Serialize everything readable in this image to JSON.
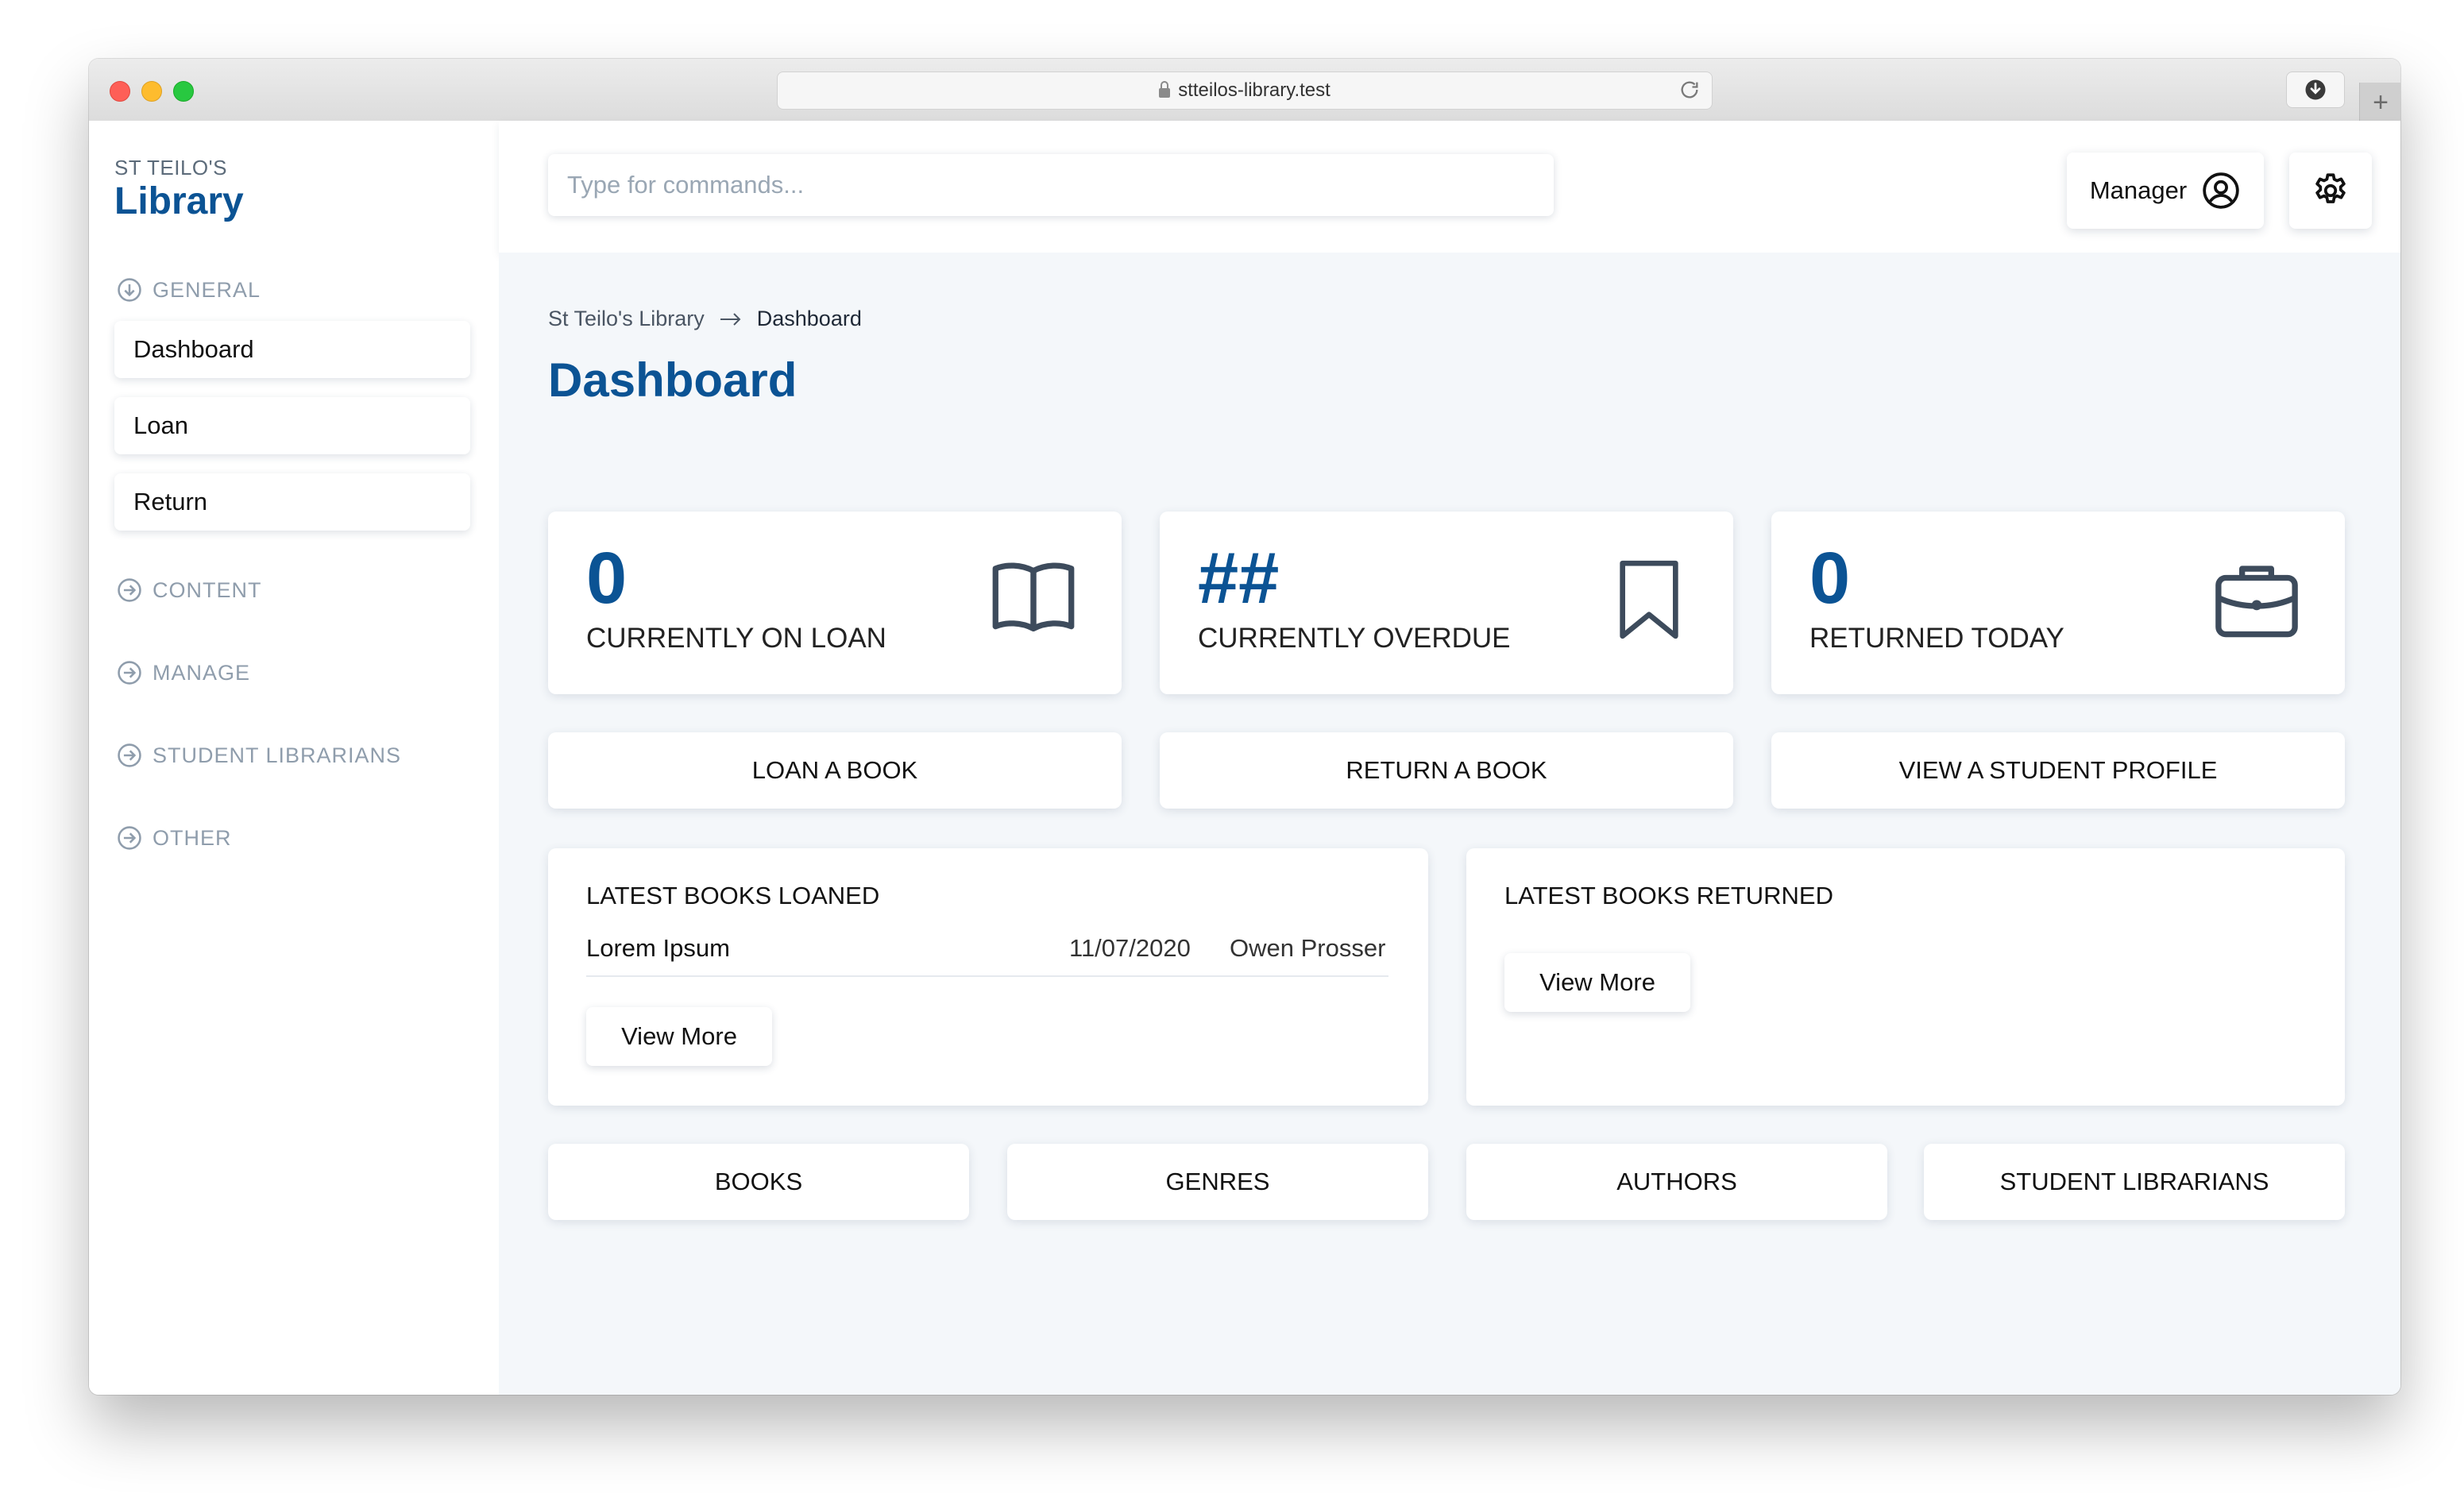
{
  "browser": {
    "url": "stteilos-library.test",
    "new_tab": "+"
  },
  "sidebar": {
    "brand_top": "ST TEILO'S",
    "brand_main": "Library",
    "sections": [
      {
        "label": "GENERAL",
        "items": [
          {
            "label": "Dashboard"
          },
          {
            "label": "Loan"
          },
          {
            "label": "Return"
          }
        ]
      },
      {
        "label": "CONTENT"
      },
      {
        "label": "MANAGE"
      },
      {
        "label": "STUDENT LIBRARIANS"
      },
      {
        "label": "OTHER"
      }
    ]
  },
  "topbar": {
    "search_placeholder": "Type for commands...",
    "user_label": "Manager"
  },
  "breadcrumb": {
    "root": "St Teilo's Library",
    "current": "Dashboard"
  },
  "page_title": "Dashboard",
  "stats": [
    {
      "value": "0",
      "label": "CURRENTLY ON LOAN",
      "icon": "book-open-icon"
    },
    {
      "value": "##",
      "label": "CURRENTLY OVERDUE",
      "icon": "bookmark-icon"
    },
    {
      "value": "0",
      "label": "RETURNED TODAY",
      "icon": "briefcase-icon"
    }
  ],
  "actions": [
    {
      "label": "LOAN A BOOK"
    },
    {
      "label": "RETURN A BOOK"
    },
    {
      "label": "VIEW A STUDENT PROFILE"
    }
  ],
  "latest_loaned": {
    "title": "LATEST BOOKS LOANED",
    "rows": [
      {
        "title": "Lorem Ipsum",
        "date": "11/07/2020",
        "who": "Owen Prosser"
      }
    ],
    "view_more": "View More"
  },
  "latest_returned": {
    "title": "LATEST BOOKS RETURNED",
    "view_more": "View More"
  },
  "links": [
    {
      "label": "BOOKS"
    },
    {
      "label": "GENRES"
    },
    {
      "label": "AUTHORS"
    },
    {
      "label": "STUDENT LIBRARIANS"
    }
  ],
  "colors": {
    "brand": "#0b5394",
    "background": "#f4f7fa",
    "muted": "#8f9dac"
  }
}
